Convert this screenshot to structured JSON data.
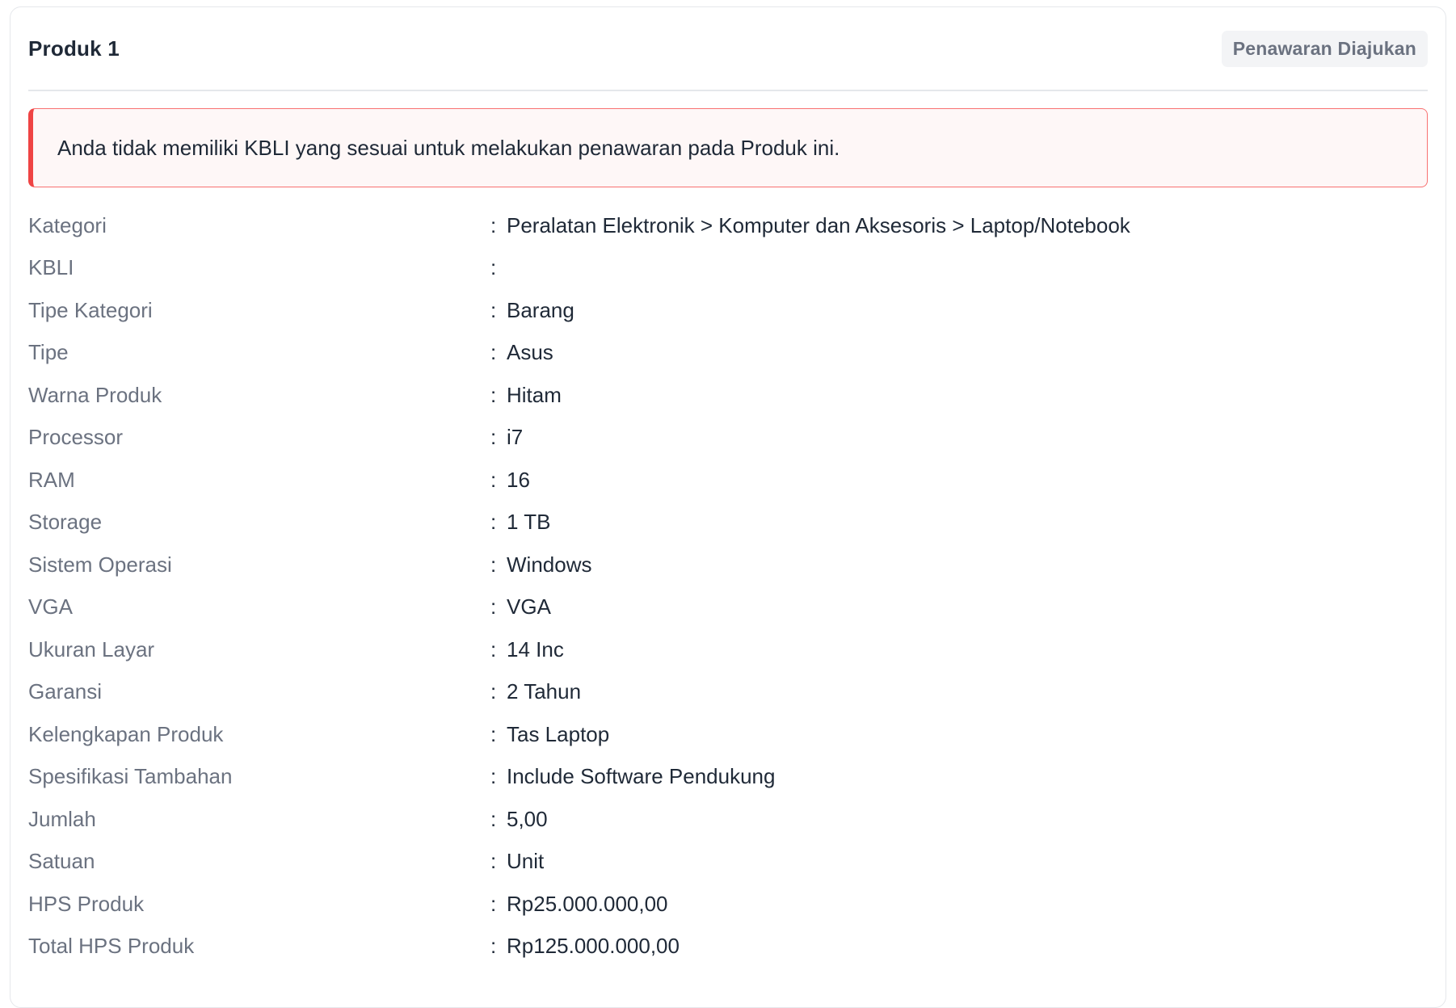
{
  "card": {
    "title": "Produk 1",
    "status": "Penawaran Diajukan",
    "alert": "Anda tidak memiliki KBLI yang sesuai untuk melakukan penawaran pada Produk ini."
  },
  "separator": ":",
  "rows": [
    {
      "label": "Kategori",
      "value": "Peralatan Elektronik > Komputer dan Aksesoris > Laptop/Notebook"
    },
    {
      "label": "KBLI",
      "value": ""
    },
    {
      "label": "Tipe Kategori",
      "value": "Barang"
    },
    {
      "label": "Tipe",
      "value": "Asus"
    },
    {
      "label": "Warna Produk",
      "value": "Hitam"
    },
    {
      "label": "Processor",
      "value": "i7"
    },
    {
      "label": "RAM",
      "value": "16"
    },
    {
      "label": "Storage",
      "value": "1 TB"
    },
    {
      "label": "Sistem Operasi",
      "value": "Windows"
    },
    {
      "label": "VGA",
      "value": "VGA"
    },
    {
      "label": "Ukuran Layar",
      "value": "14 Inc"
    },
    {
      "label": "Garansi",
      "value": "2 Tahun"
    },
    {
      "label": "Kelengkapan Produk",
      "value": "Tas Laptop"
    },
    {
      "label": "Spesifikasi Tambahan",
      "value": "Include Software Pendukung"
    },
    {
      "label": "Jumlah",
      "value": "5,00"
    },
    {
      "label": "Satuan",
      "value": "Unit"
    },
    {
      "label": "HPS Produk",
      "value": "Rp25.000.000,00"
    },
    {
      "label": "Total HPS Produk",
      "value": "Rp125.000.000,00"
    }
  ],
  "colors": {
    "alert_border": "#ef4444",
    "alert_background": "#fef7f7",
    "badge_background": "#f3f4f6",
    "label_text": "#6b7280",
    "value_text": "#1f2937"
  }
}
